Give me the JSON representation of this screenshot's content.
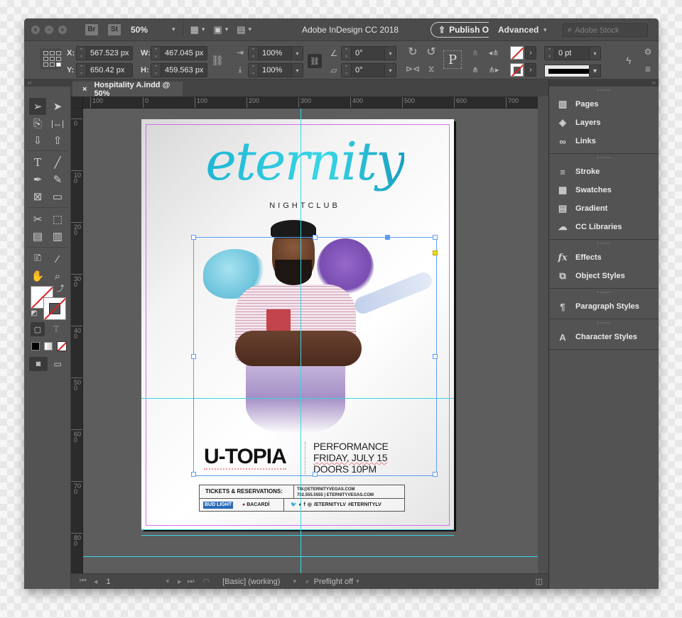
{
  "app": {
    "title": "Adobe InDesign CC 2018",
    "zoom": "50%",
    "bridge_badge": "Br",
    "stock_badge": "St",
    "publish_label": "Publish O",
    "workspace": "Advanced",
    "stock_search_placeholder": "Adobe Stock"
  },
  "window_controls": {
    "close": "×",
    "minimize": "−",
    "maximize": "+"
  },
  "control_panel": {
    "x_label": "X:",
    "x_value": "567.523 px",
    "y_label": "Y:",
    "y_value": "650.42 px",
    "w_label": "W:",
    "w_value": "467.045 px",
    "h_label": "H:",
    "h_value": "459.563 px",
    "scale_x": "100%",
    "scale_y": "100%",
    "rotation": "0°",
    "shear": "0°",
    "stroke_weight": "0 pt",
    "fill_color": "none",
    "stroke_color": "none"
  },
  "document": {
    "tab_label": "Hospitality A.indd @ 50%",
    "tab_close": "×"
  },
  "rulers": {
    "horizontal": [
      "100",
      "0",
      "100",
      "200",
      "300",
      "400",
      "500",
      "600",
      "700"
    ],
    "vertical": [
      "0",
      "100",
      "200",
      "300",
      "400",
      "500",
      "600",
      "700",
      "800"
    ]
  },
  "poster": {
    "logo": "eternity",
    "logo_sub": "NIGHTCLUB",
    "event_title": "U-TOPIA",
    "event_lines": [
      "PERFORMANCE",
      "FRIDAY, JULY 15",
      "DOORS 10PM"
    ],
    "tickets_label": "TICKETS & RESERVATIONS:",
    "contact_email": "TIX@ETERNITYVEGAS.COM",
    "contact_phone_site": "702.555.5555  |  ETERNITYVEGAS.COM",
    "sponsor_1": "BUD LIGHT",
    "sponsor_2": "BACARDÍ",
    "social_handle": "/ETERNITYLV",
    "social_hashtag": "#ETERNITYLV",
    "colors": {
      "logo": "#2bc8dc",
      "selection": "#5d9ef5",
      "guide": "#39d5e6",
      "margin": "#d46ee8"
    }
  },
  "status_bar": {
    "page_number": "1",
    "style": "[Basic] (working)",
    "preflight": "Preflight off"
  },
  "panels": {
    "groups": [
      [
        {
          "label": "Pages",
          "icon": "pages-icon",
          "glyph": "▥"
        },
        {
          "label": "Layers",
          "icon": "layers-icon",
          "glyph": "◈"
        },
        {
          "label": "Links",
          "icon": "links-icon",
          "glyph": "∞"
        }
      ],
      [
        {
          "label": "Stroke",
          "icon": "stroke-icon",
          "glyph": "≡"
        },
        {
          "label": "Swatches",
          "icon": "swatches-icon",
          "glyph": "▦"
        },
        {
          "label": "Gradient",
          "icon": "gradient-icon",
          "glyph": "▤"
        },
        {
          "label": "CC Libraries",
          "icon": "cc-libraries-icon",
          "glyph": "☁"
        }
      ],
      [
        {
          "label": "Effects",
          "icon": "effects-icon",
          "glyph": "fx"
        },
        {
          "label": "Object Styles",
          "icon": "object-styles-icon",
          "glyph": "⧉"
        }
      ],
      [
        {
          "label": "Paragraph Styles",
          "icon": "paragraph-styles-icon",
          "glyph": "¶"
        }
      ],
      [
        {
          "label": "Character Styles",
          "icon": "character-styles-icon",
          "glyph": "A"
        }
      ]
    ]
  },
  "tools": {
    "type_glyph": "T",
    "apply_text_glyph": "T"
  }
}
